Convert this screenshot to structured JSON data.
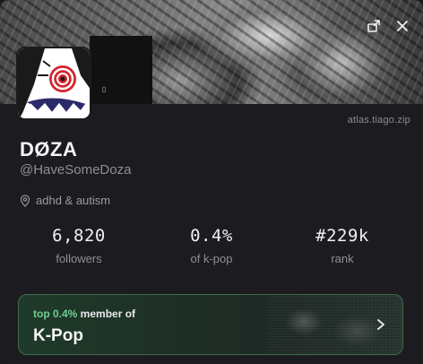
{
  "banner": {
    "mini_glyph": "▯",
    "share_icon": "share-icon",
    "close_icon": "close-icon"
  },
  "profile": {
    "source_domain": "atlas.tiago.zip",
    "name": "DØZA",
    "handle": "@HaveSomeDoza",
    "bio": "adhd & autism",
    "bio_icon": "location-pin-icon"
  },
  "stats": [
    {
      "value": "6,820",
      "label": "followers"
    },
    {
      "value": "0.4%",
      "label": "of k-pop"
    },
    {
      "value": "#229k",
      "label": "rank"
    }
  ],
  "community": {
    "percent_prefix": "top 0.4%",
    "percent_suffix": " member of",
    "name": "K-Pop",
    "chevron_icon": "chevron-right-icon"
  },
  "colors": {
    "background": "#1c1c20",
    "accent_green": "#6fcf8f",
    "card_border": "#3f6a4f",
    "muted_text": "#8e8e96"
  }
}
